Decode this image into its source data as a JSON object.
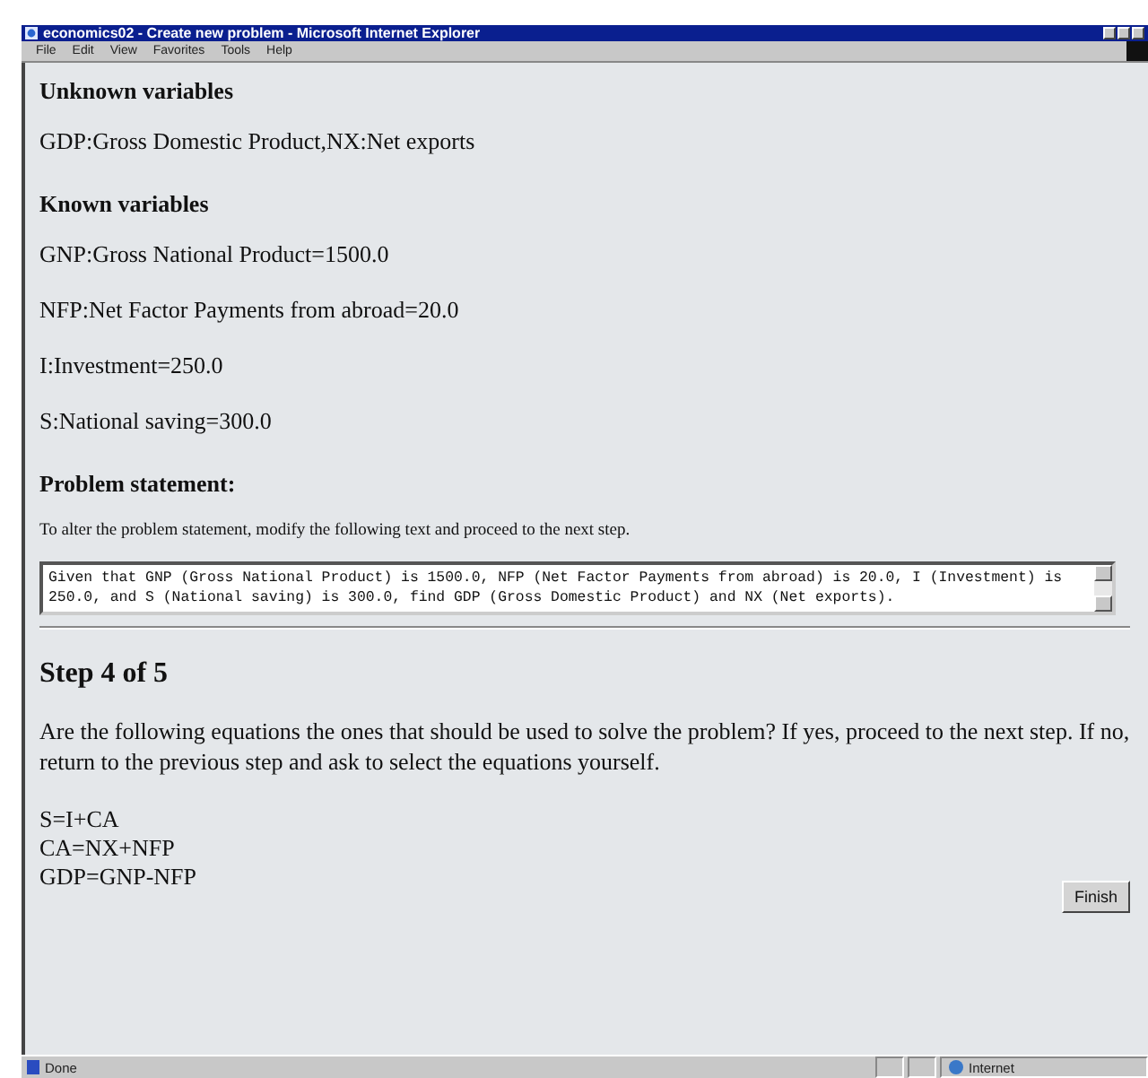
{
  "window": {
    "title": "economics02 - Create new problem - Microsoft Internet Explorer"
  },
  "menu": [
    "File",
    "Edit",
    "View",
    "Favorites",
    "Tools",
    "Help"
  ],
  "unknown": {
    "heading": "Unknown variables",
    "text": "GDP:Gross Domestic Product,NX:Net exports"
  },
  "known": {
    "heading": "Known variables",
    "items": [
      "GNP:Gross National Product=1500.0",
      "NFP:Net Factor Payments from abroad=20.0",
      "I:Investment=250.0",
      "S:National saving=300.0"
    ]
  },
  "problem": {
    "heading": "Problem statement:",
    "hint": "To alter the problem statement, modify the following text and proceed to the next step.",
    "value": "Given that GNP (Gross National Product) is 1500.0, NFP (Net Factor Payments from abroad) is 20.0, I (Investment) is 250.0, and S (National saving) is 300.0, find GDP (Gross Domestic Product) and NX (Net exports)."
  },
  "step": {
    "heading": "Step 4 of 5",
    "question": "Are the following equations the ones that should be used to solve the problem? If yes, proceed to the next step. If no, return to the previous step and ask to select the equations yourself.",
    "equations": [
      "S=I+CA",
      "CA=NX+NFP",
      "GDP=GNP-NFP"
    ]
  },
  "buttons": [
    "Finish"
  ],
  "status_bar": {
    "text": "Done",
    "zone": "Internet"
  }
}
